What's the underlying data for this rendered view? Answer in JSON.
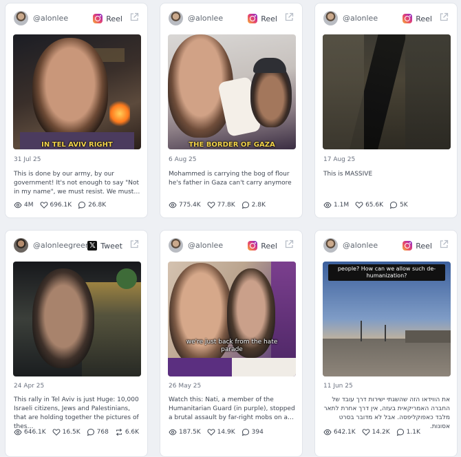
{
  "cards": [
    {
      "handle": "@alonlee",
      "platform": "Reel",
      "platform_icon": "instagram-icon",
      "date": "31 Jul 25",
      "caption_overlay": "IN TEL AVIV RIGHT",
      "text": "This is done by our army, by our government! It's not enough to say \"Not in my name\", we must resist. We must…",
      "stats": {
        "views": "4M",
        "likes": "696.1K",
        "comments": "26.8K"
      }
    },
    {
      "handle": "@alonlee",
      "platform": "Reel",
      "platform_icon": "instagram-icon",
      "date": "6 Aug 25",
      "caption_overlay": "THE BORDER OF GAZA",
      "text": "Mohammed is carrying the bog of flour he's father in Gaza can't carry anymore",
      "stats": {
        "views": "775.4K",
        "likes": "77.8K",
        "comments": "2.8K"
      }
    },
    {
      "handle": "@alonlee",
      "platform": "Reel",
      "platform_icon": "instagram-icon",
      "date": "17 Aug 25",
      "text": "This is MASSIVE",
      "stats": {
        "views": "1.1M",
        "likes": "65.6K",
        "comments": "5K"
      }
    },
    {
      "handle": "@alonleegreen",
      "platform": "Tweet",
      "platform_icon": "x-icon",
      "date": "24 Apr 25",
      "text": "This rally in Tel Aviv is just Huge: 10,000 Israeli citizens, Jews and Palestinians, that are holding together the pictures of thes…",
      "stats": {
        "views": "646.1K",
        "likes": "16.5K",
        "comments": "768",
        "reposts": "6.6K"
      }
    },
    {
      "handle": "@alonlee",
      "platform": "Reel",
      "platform_icon": "instagram-icon",
      "date": "26 May 25",
      "subtitle": "we're just back from the hate parade",
      "text": "Watch this: Nati, a member of the Humanitarian Guard (in purple), stopped a brutal assault by far-right mobs on a…",
      "stats": {
        "views": "187.5K",
        "likes": "14.9K",
        "comments": "394"
      }
    },
    {
      "handle": "@alonlee",
      "platform": "Reel",
      "platform_icon": "instagram-icon",
      "date": "11 Jun 25",
      "banner": "people? How can we allow such de-humanization?",
      "text": "את הווידאו הזה שהשגתי ישירות דרך עובד של החברה האמריקאית בעזה, אין דרך אחרת לתאר מלבד כאפוקליפסה. אבל לא מדובר בסרט אסונות.",
      "stats": {
        "views": "642.1K",
        "likes": "14.2K",
        "comments": "1.1K"
      }
    }
  ]
}
